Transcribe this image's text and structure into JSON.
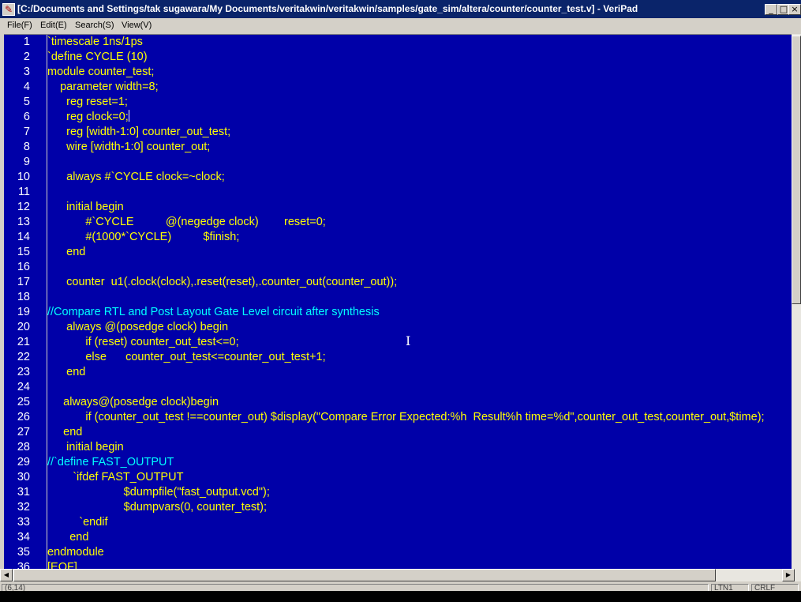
{
  "window": {
    "title": "[C:/Documents and Settings/tak sugawara/My Documents/veritakwin/veritakwin/samples/gate_sim/altera/counter/counter_test.v] - VeriPad",
    "icon": "veripad-app-icon",
    "controls": {
      "minimize": "_",
      "maximize": "□",
      "close": "×"
    }
  },
  "menu": [
    {
      "label": "File(F)"
    },
    {
      "label": "Edit(E)"
    },
    {
      "label": "Search(S)"
    },
    {
      "label": "View(V)"
    }
  ],
  "colors": {
    "editor_bg": "#0000a8",
    "keyword": "#ffff00",
    "comment": "#00ffff",
    "text": "#ffffff"
  },
  "editor": {
    "lines": [
      {
        "num": "1",
        "text": "`timescale 1ns/1ps"
      },
      {
        "num": "2",
        "text": "`define CYCLE (10)"
      },
      {
        "num": "3",
        "text": "module counter_test;"
      },
      {
        "num": "4",
        "text": "    parameter width=8;"
      },
      {
        "num": "5",
        "text": "      reg reset=1;"
      },
      {
        "num": "6",
        "text": "      reg clock=0;"
      },
      {
        "num": "7",
        "text": "      reg [width-1:0] counter_out_test;"
      },
      {
        "num": "8",
        "text": "      wire [width-1:0] counter_out;"
      },
      {
        "num": "9",
        "text": ""
      },
      {
        "num": "10",
        "text": "      always #`CYCLE clock=~clock;"
      },
      {
        "num": "11",
        "text": ""
      },
      {
        "num": "12",
        "text": "      initial begin"
      },
      {
        "num": "13",
        "text": "            #`CYCLE          @(negedge clock)        reset=0;"
      },
      {
        "num": "14",
        "text": "            #(1000*`CYCLE)          $finish;"
      },
      {
        "num": "15",
        "text": "      end"
      },
      {
        "num": "16",
        "text": ""
      },
      {
        "num": "17",
        "text": "      counter  u1(.clock(clock),.reset(reset),.counter_out(counter_out));"
      },
      {
        "num": "18",
        "text": ""
      },
      {
        "num": "19",
        "text": "//Compare RTL and Post Layout Gate Level circuit after synthesis"
      },
      {
        "num": "20",
        "text": "      always @(posedge clock) begin"
      },
      {
        "num": "21",
        "text": "            if (reset) counter_out_test<=0;"
      },
      {
        "num": "22",
        "text": "            else      counter_out_test<=counter_out_test+1;"
      },
      {
        "num": "23",
        "text": "      end"
      },
      {
        "num": "24",
        "text": ""
      },
      {
        "num": "25",
        "text": "     always@(posedge clock)begin"
      },
      {
        "num": "26",
        "text": "            if (counter_out_test !==counter_out) $display(\"Compare Error Expected:%h  Result%h time=%d\",counter_out_test,counter_out,$time);"
      },
      {
        "num": "27",
        "text": "     end"
      },
      {
        "num": "28",
        "text": "      initial begin"
      },
      {
        "num": "29",
        "text": "//`define FAST_OUTPUT"
      },
      {
        "num": "30",
        "text": "        `ifdef FAST_OUTPUT"
      },
      {
        "num": "31",
        "text": "                        $dumpfile(\"fast_output.vcd\");"
      },
      {
        "num": "32",
        "text": "                        $dumpvars(0, counter_test);"
      },
      {
        "num": "33",
        "text": "          `endif"
      },
      {
        "num": "34",
        "text": "       end"
      },
      {
        "num": "35",
        "text": "endmodule"
      },
      {
        "num": "36",
        "text": "[EOF]"
      }
    ]
  },
  "status": {
    "position": "(6,14)",
    "line_ending": "LTN1",
    "mode": "CRLF"
  }
}
